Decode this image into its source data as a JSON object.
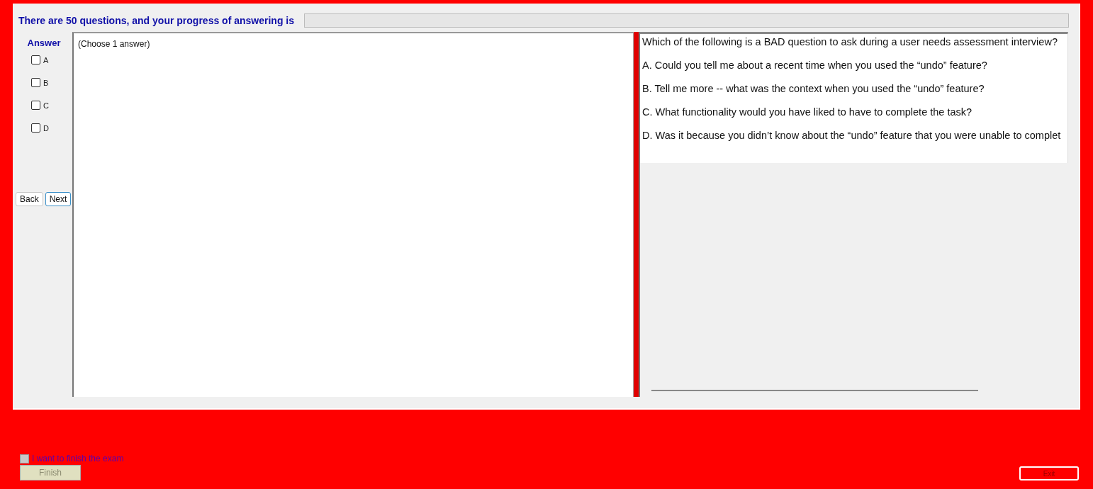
{
  "header": {
    "text": "There are 50 questions, and your progress of answering is",
    "progress": {
      "level": 0
    }
  },
  "answer_panel": {
    "title": "Answer",
    "options": [
      {
        "label": "A",
        "checked": false
      },
      {
        "label": "B",
        "checked": false
      },
      {
        "label": "C",
        "checked": false
      },
      {
        "label": "D",
        "checked": false
      }
    ],
    "buttons": [
      {
        "label": "Back",
        "focused": false
      },
      {
        "label": "Next",
        "focused": true
      }
    ]
  },
  "answer_area": {
    "hint": "(Choose 1 answer)"
  },
  "question": {
    "text": "Which of the following is a BAD question to ask during a user needs assessment interview?",
    "choices": [
      "A.  Could you tell me about a recent time when you used the “undo” feature?",
      "B.  Tell me more -- what was the context when you used the “undo” feature?",
      "C.  What functionality would you have liked to have to complete the task?",
      "D.  Was it because you didn’t know about the “undo” feature that you were unable to complet"
    ]
  },
  "footer": {
    "finish_checkbox": {
      "label": "I want to finish the exam",
      "checked": false
    },
    "finish_button": {
      "label": "Finish",
      "disabled": true
    },
    "exit_button": {
      "label": "Exit"
    }
  }
}
